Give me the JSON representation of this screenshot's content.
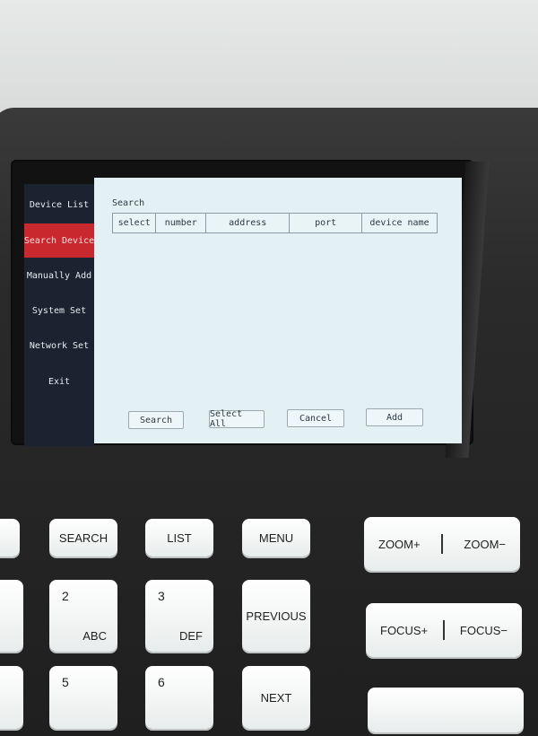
{
  "sidebar": {
    "items": [
      {
        "label": "Device List"
      },
      {
        "label": "Search Device",
        "active": true
      },
      {
        "label": "Manually Add"
      },
      {
        "label": "System Set"
      },
      {
        "label": "Network Set"
      },
      {
        "label": "Exit"
      }
    ]
  },
  "main": {
    "title": "Search",
    "columns": [
      "select",
      "number",
      "address",
      "port",
      "device name"
    ],
    "buttons": {
      "search": "Search",
      "select_all": "Select All",
      "cancel": "Cancel",
      "add": "Add"
    }
  },
  "keypad": {
    "search": "SEARCH",
    "list": "LIST",
    "menu": "MENU",
    "zoom_in": "ZOOM+",
    "zoom_out": "ZOOM−",
    "focus_in": "FOCUS+",
    "focus_out": "FOCUS−",
    "key2_num": "2",
    "key2_letters": "ABC",
    "key3_num": "3",
    "key3_letters": "DEF",
    "previous": "PREVIOUS",
    "key5_num": "5",
    "key6_num": "6",
    "next": "NEXT"
  },
  "colors": {
    "sidebar_bg": "#1b2330",
    "active_item": "#c8282e",
    "screen_bg": "#e4f1f4"
  }
}
